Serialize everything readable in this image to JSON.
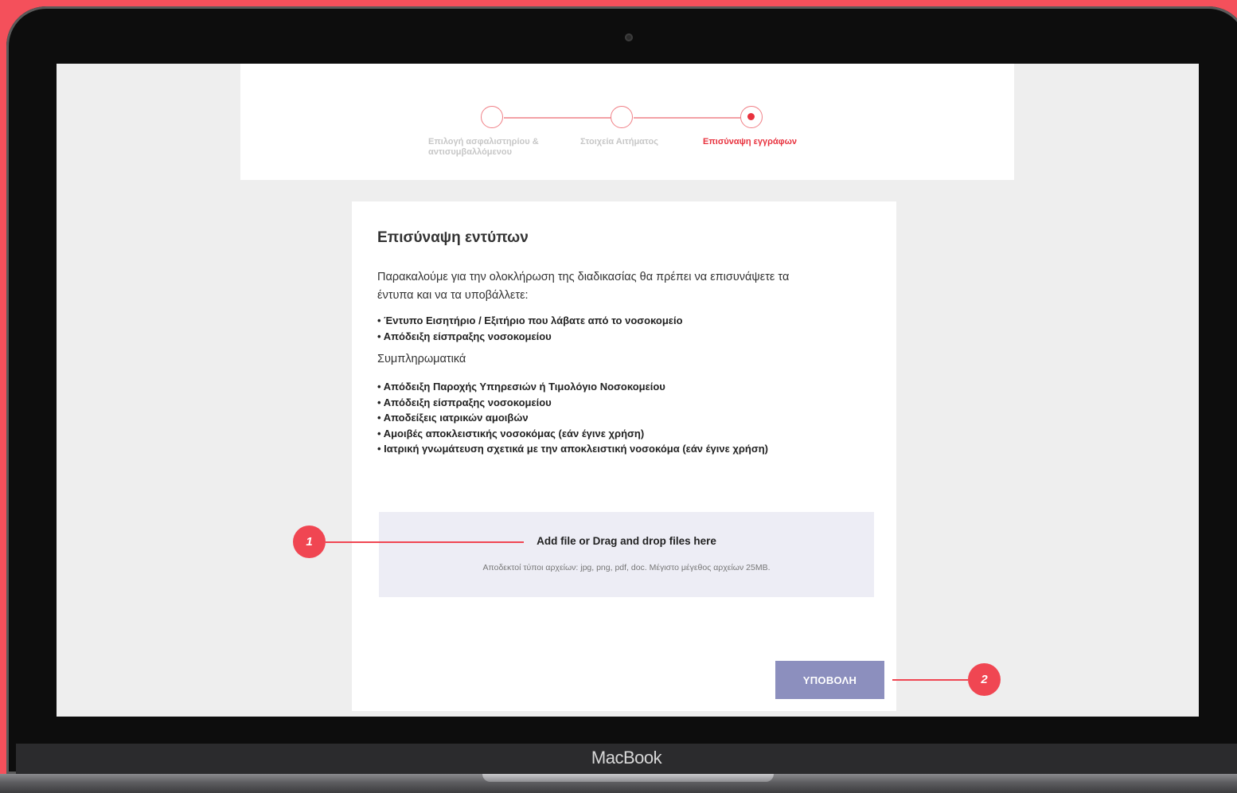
{
  "device": {
    "label": "MacBook"
  },
  "stepper": {
    "steps": [
      {
        "label_line1": "Επιλογή ασφαλιστηρίου &",
        "label_line2": "αντισυμβαλλόμενου",
        "state": "completed"
      },
      {
        "label_line1": "Στοιχεία Αιτήματος",
        "label_line2": "",
        "state": "completed"
      },
      {
        "label_line1": "Επισύναψη εγγράφων",
        "label_line2": "",
        "state": "active"
      }
    ]
  },
  "content": {
    "title": "Επισύναψη εντύπων",
    "intro": "Παρακαλούμε για την ολοκλήρωση της διαδικασίας θα πρέπει να επισυνάψετε τα έντυπα και να τα υποβάλλετε:",
    "required_docs": [
      "Έντυπο Εισητήριο / Εξιτήριο που λάβατε από το νοσοκομείο",
      "Απόδειξη είσπραξης νοσοκομείου"
    ],
    "extra_heading": "Συμπληρωματικά",
    "extra_docs": [
      "Απόδειξη Παροχής Υπηρεσιών ή Τιμολόγιο Νοσοκομείου",
      "Απόδειξη είσπραξης νοσοκομείου",
      "Αποδείξεις ιατρικών αμοιβών",
      "Αμοιβές αποκλειστικής νοσοκόμας (εάν έγινε χρήση)",
      "Ιατρική γνωμάτευση σχετικά με την αποκλειστική νοσοκόμα (εάν έγινε χρήση)"
    ],
    "dropzone": {
      "main": "Add file or Drag and drop files here",
      "sub": "Αποδεκτοί τύποι αρχείων: jpg, png, pdf, doc. Μέγιστο μέγεθος αρχείων 25MB."
    },
    "submit_label": "ΥΠΟΒΟΛΗ"
  },
  "callouts": {
    "one": "1",
    "two": "2"
  },
  "colors": {
    "accent": "#e8323e",
    "button": "#8c8fbe",
    "dropzone": "#ededf5",
    "background": "#f4505b"
  }
}
